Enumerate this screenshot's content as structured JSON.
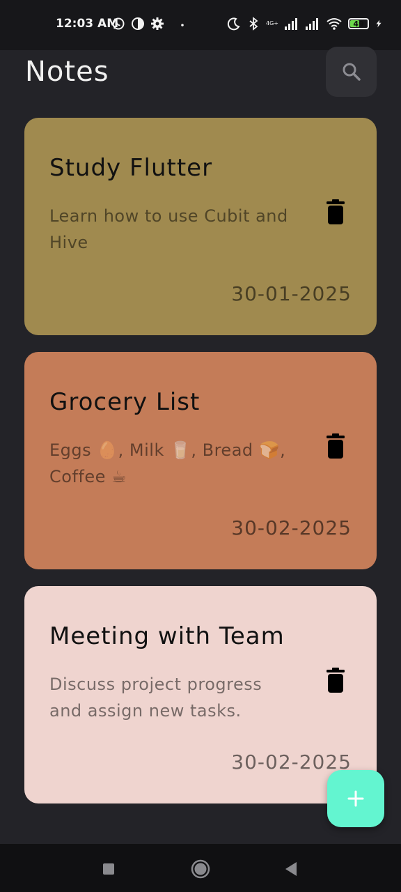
{
  "status_bar": {
    "time": "12:03 AM",
    "battery_level": 49,
    "battery_label": "49",
    "network_type": "4G+",
    "icons": [
      "whatsapp-icon",
      "pie-icon",
      "settings-icon",
      "dot-icon",
      "moon-icon",
      "bluetooth-icon",
      "signal-icon",
      "signal-icon",
      "wifi-icon",
      "battery-icon",
      "charging-icon"
    ]
  },
  "header": {
    "title": "Notes",
    "search_icon": "search-icon"
  },
  "notes": [
    {
      "title": "Study Flutter",
      "content": "Learn how to use Cubit and Hive",
      "date": "30-01-2025",
      "color": "#a08a4f"
    },
    {
      "title": "Grocery List",
      "content": "Eggs 🥚, Milk 🥛, Bread 🍞, Coffee ☕",
      "date": "30-02-2025",
      "color": "#c47c58"
    },
    {
      "title": "Meeting with Team",
      "content": "Discuss project progress and assign new tasks.",
      "date": "30-02-2025",
      "color": "#efd4cf"
    }
  ],
  "fab": {
    "icon": "plus-icon",
    "color": "#63f5d0"
  },
  "nav_bar": {
    "icons": [
      "recent-apps-icon",
      "home-icon",
      "back-icon"
    ]
  }
}
